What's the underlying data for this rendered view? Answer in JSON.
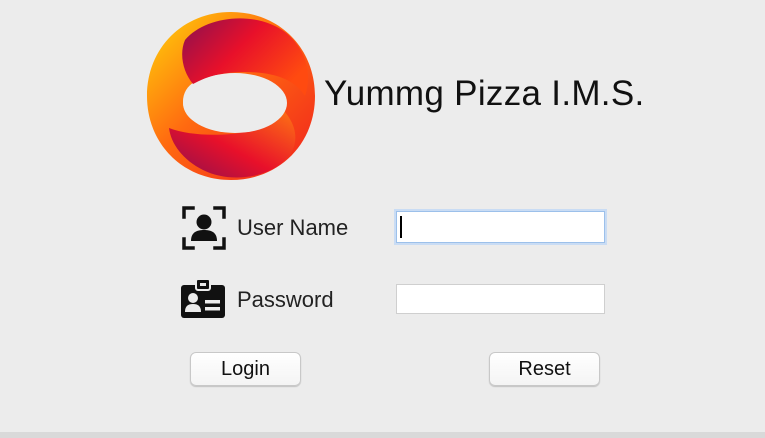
{
  "app": {
    "title": "Yummg Pizza I.M.S."
  },
  "form": {
    "username_label": "User Name",
    "username_value": "",
    "password_label": "Password",
    "password_value": ""
  },
  "buttons": {
    "login_label": "Login",
    "reset_label": "Reset"
  },
  "icons": {
    "logo": "ring-logo",
    "user": "user-scan-icon",
    "password": "id-badge-icon"
  },
  "colors": {
    "logo_red": "#e8102a",
    "logo_orange": "#ff6a10",
    "logo_yellow": "#ffd60a",
    "logo_purple": "#8a1050",
    "focus_ring": "#9cc0ea"
  }
}
